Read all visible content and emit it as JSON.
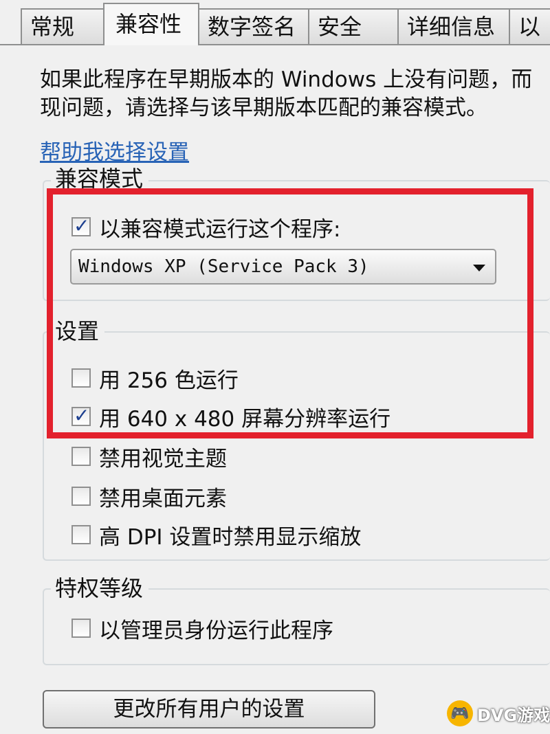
{
  "tabs": [
    {
      "label": "常规"
    },
    {
      "label": "兼容性"
    },
    {
      "label": "数字签名"
    },
    {
      "label": "安全"
    },
    {
      "label": "详细信息"
    },
    {
      "label": "以"
    }
  ],
  "description": {
    "line1": "如果此程序在早期版本的 Windows 上没有问题，而",
    "line2": "现问题，请选择与该早期版本匹配的兼容模式。"
  },
  "help_link": "帮助我选择设置",
  "compat_mode": {
    "title": "兼容模式",
    "run_in_compat": {
      "label": "以兼容模式运行这个程序:",
      "checked": true
    },
    "os_select": {
      "value": "Windows XP (Service Pack 3)"
    }
  },
  "settings": {
    "title": "设置",
    "items": [
      {
        "label": "用 256 色运行",
        "checked": false
      },
      {
        "label": "用 640 x 480 屏幕分辨率运行",
        "checked": true
      },
      {
        "label": "禁用视觉主题",
        "checked": false
      },
      {
        "label": "禁用桌面元素",
        "checked": false
      },
      {
        "label": "高 DPI 设置时禁用显示缩放",
        "checked": false
      }
    ]
  },
  "privilege": {
    "title": "特权等级",
    "run_as_admin": {
      "label": "以管理员身份运行此程序",
      "checked": false
    }
  },
  "change_all_users_button": "更改所有用户的设置",
  "watermark": {
    "text": "DVG游戏网"
  },
  "colors": {
    "highlight": "#e3212d",
    "link": "#2863b6"
  }
}
